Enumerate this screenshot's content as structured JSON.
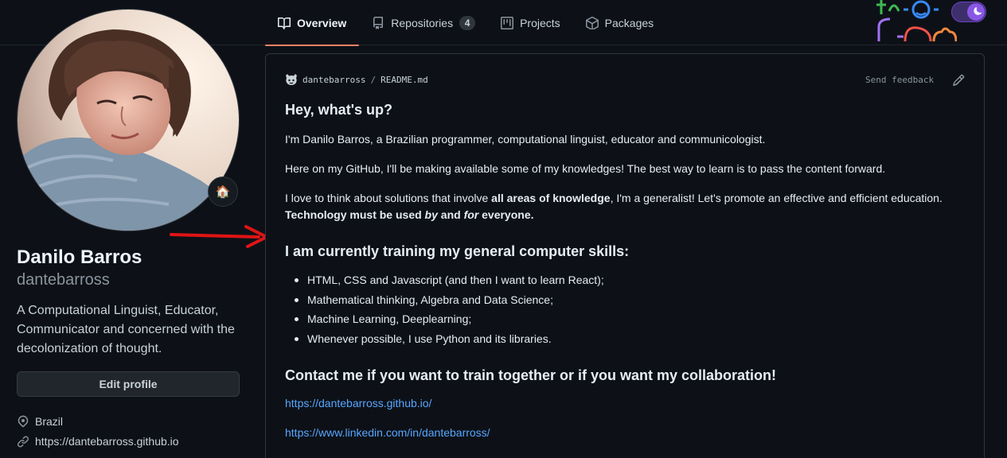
{
  "nav": {
    "tabs": [
      {
        "label": "Overview",
        "selected": true,
        "icon": "book-icon"
      },
      {
        "label": "Repositories",
        "count": "4",
        "icon": "repo-icon"
      },
      {
        "label": "Projects",
        "icon": "project-icon"
      },
      {
        "label": "Packages",
        "icon": "package-icon"
      }
    ]
  },
  "profile": {
    "name": "Danilo Barros",
    "username": "dantebarross",
    "bio": "A Computational Linguist, Educator, Communicator and concerned with the decolonization of thought.",
    "edit_button": "Edit profile",
    "status_emoji": "🏠",
    "location": "Brazil",
    "website": "https://dantebarross.github.io"
  },
  "readme": {
    "owner": "dantebarross",
    "separator": "/",
    "file": "README.md",
    "feedback": "Send feedback",
    "heading1": "Hey, what's up?",
    "para1": "I'm Danilo Barros, a Brazilian programmer, computational linguist, educator and communicologist.",
    "para2": "Here on my GitHub, I'll be making available some of my knowledges! The best way to learn is to pass the content forward.",
    "para3_a": "I love to think about solutions that involve ",
    "para3_b": "all areas of knowledge",
    "para3_c": ", I'm a generalist! Let's promote an effective and efficient education.",
    "para3_d": "Technology must be used ",
    "para3_e": "by",
    "para3_f": " and ",
    "para3_g": "for",
    "para3_h": " everyone.",
    "heading2": "I am currently training my general computer skills:",
    "skills": [
      "HTML, CSS and Javascript (and then I want to learn React);",
      "Mathematical thinking, Algebra and Data Science;",
      "Machine Learning, Deeplearning;",
      "Whenever possible, I use Python and its libraries."
    ],
    "heading3": "Contact me if you want to train together or if you want my collaboration!",
    "link1": "https://dantebarross.github.io/",
    "link2": "https://www.linkedin.com/in/dantebarross/"
  },
  "colors": {
    "background": "#0d1117",
    "tab_underline": "#f78166",
    "link": "#58a6ff",
    "annotation_arrow": "#e01414"
  }
}
